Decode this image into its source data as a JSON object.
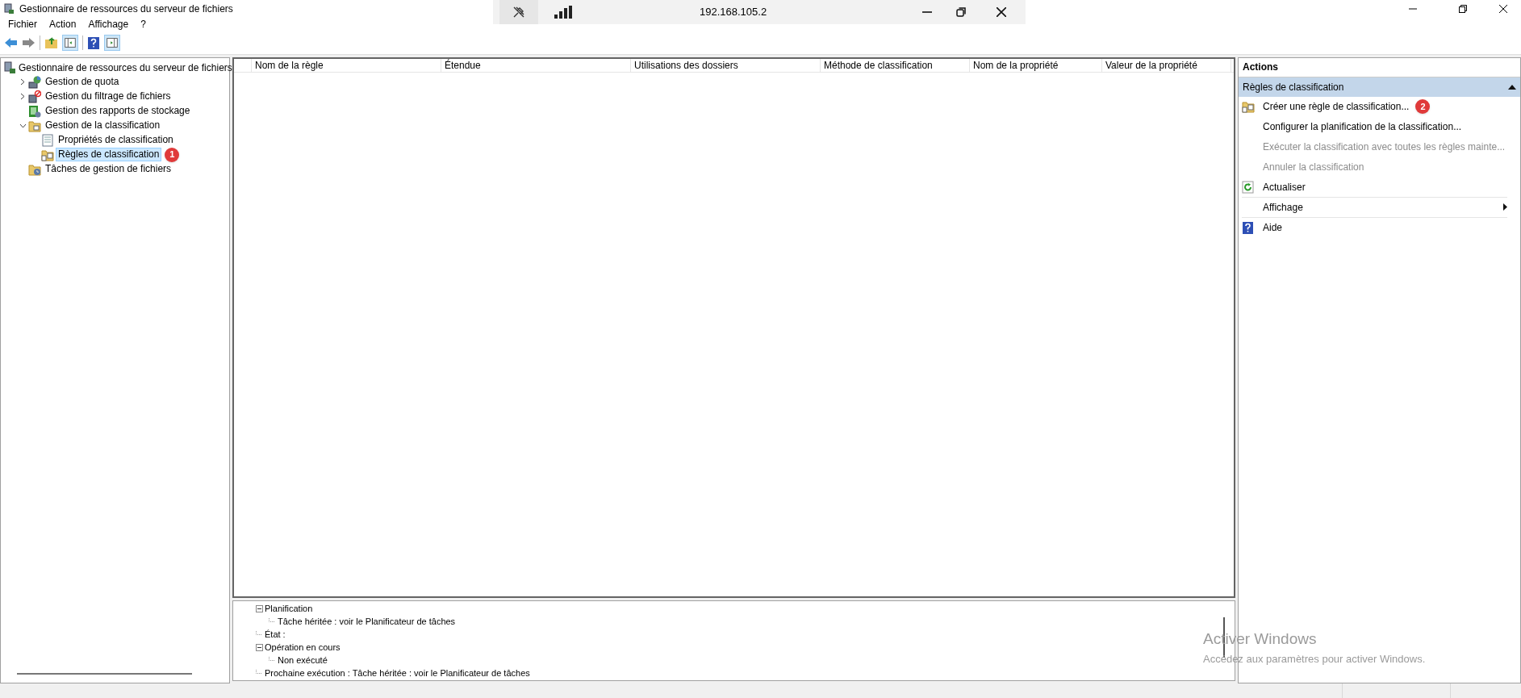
{
  "window": {
    "title": "Gestionnaire de ressources du serveur de fichiers"
  },
  "remote_bar": {
    "address": "192.168.105.2"
  },
  "menu": [
    "Fichier",
    "Action",
    "Affichage",
    "?"
  ],
  "tree": {
    "label": "Gestionnaire de ressources du serveur de fichiers",
    "kind": "server",
    "children": [
      {
        "label": "Gestion de quota",
        "kind": "quota",
        "expanded": false,
        "selected": false
      },
      {
        "label": "Gestion du filtrage de fichiers",
        "kind": "filter",
        "expanded": false,
        "selected": false
      },
      {
        "label": "Gestion des rapports de stockage",
        "kind": "report",
        "selected": false
      },
      {
        "label": "Gestion de la classification",
        "kind": "folder",
        "expanded": true,
        "selected": false,
        "children": [
          {
            "label": "Propriétés de classification",
            "kind": "properties",
            "selected": false
          },
          {
            "label": "Règles de classification",
            "kind": "rules",
            "selected": true,
            "badge": "1"
          }
        ]
      },
      {
        "label": "Tâches de gestion de fichiers",
        "kind": "tasks",
        "selected": false
      }
    ]
  },
  "table": {
    "columns": [
      "Nom de la règle",
      "Étendue",
      "Utilisations des dossiers",
      "Méthode de classification",
      "Nom de la propriété",
      "Valeur de la propriété"
    ]
  },
  "details": [
    {
      "label": "Planification",
      "expanded": true,
      "children": [
        {
          "label": "Tâche héritée : voir le Planificateur de tâches"
        }
      ]
    },
    {
      "label": "État :"
    },
    {
      "label": "Opération en cours",
      "expanded": true,
      "children": [
        {
          "label": "Non exécuté"
        }
      ]
    },
    {
      "label": "Prochaine exécution : Tâche héritée : voir le Planificateur de tâches"
    }
  ],
  "actions": {
    "title": "Actions",
    "section": {
      "label": "Règles de classification",
      "expanded": true
    },
    "items": [
      {
        "label": "Créer une règle de classification...",
        "kind": "rule",
        "disabled": false,
        "badge": "2"
      },
      {
        "label": "Configurer la planification de la classification...",
        "kind": "plain",
        "disabled": false
      },
      {
        "label": "Exécuter la classification avec toutes les règles mainte...",
        "kind": "plain",
        "disabled": true
      },
      {
        "label": "Annuler la classification",
        "kind": "plain",
        "disabled": true
      },
      {
        "label": "Actualiser",
        "kind": "refresh",
        "disabled": false
      },
      {
        "label": "Affichage",
        "kind": "submenu",
        "disabled": false
      },
      {
        "label": "Aide",
        "kind": "help",
        "disabled": false
      }
    ]
  },
  "activation_notice": {
    "title": "Activer Windows",
    "text": "Accédez aux paramètres pour activer Windows."
  }
}
